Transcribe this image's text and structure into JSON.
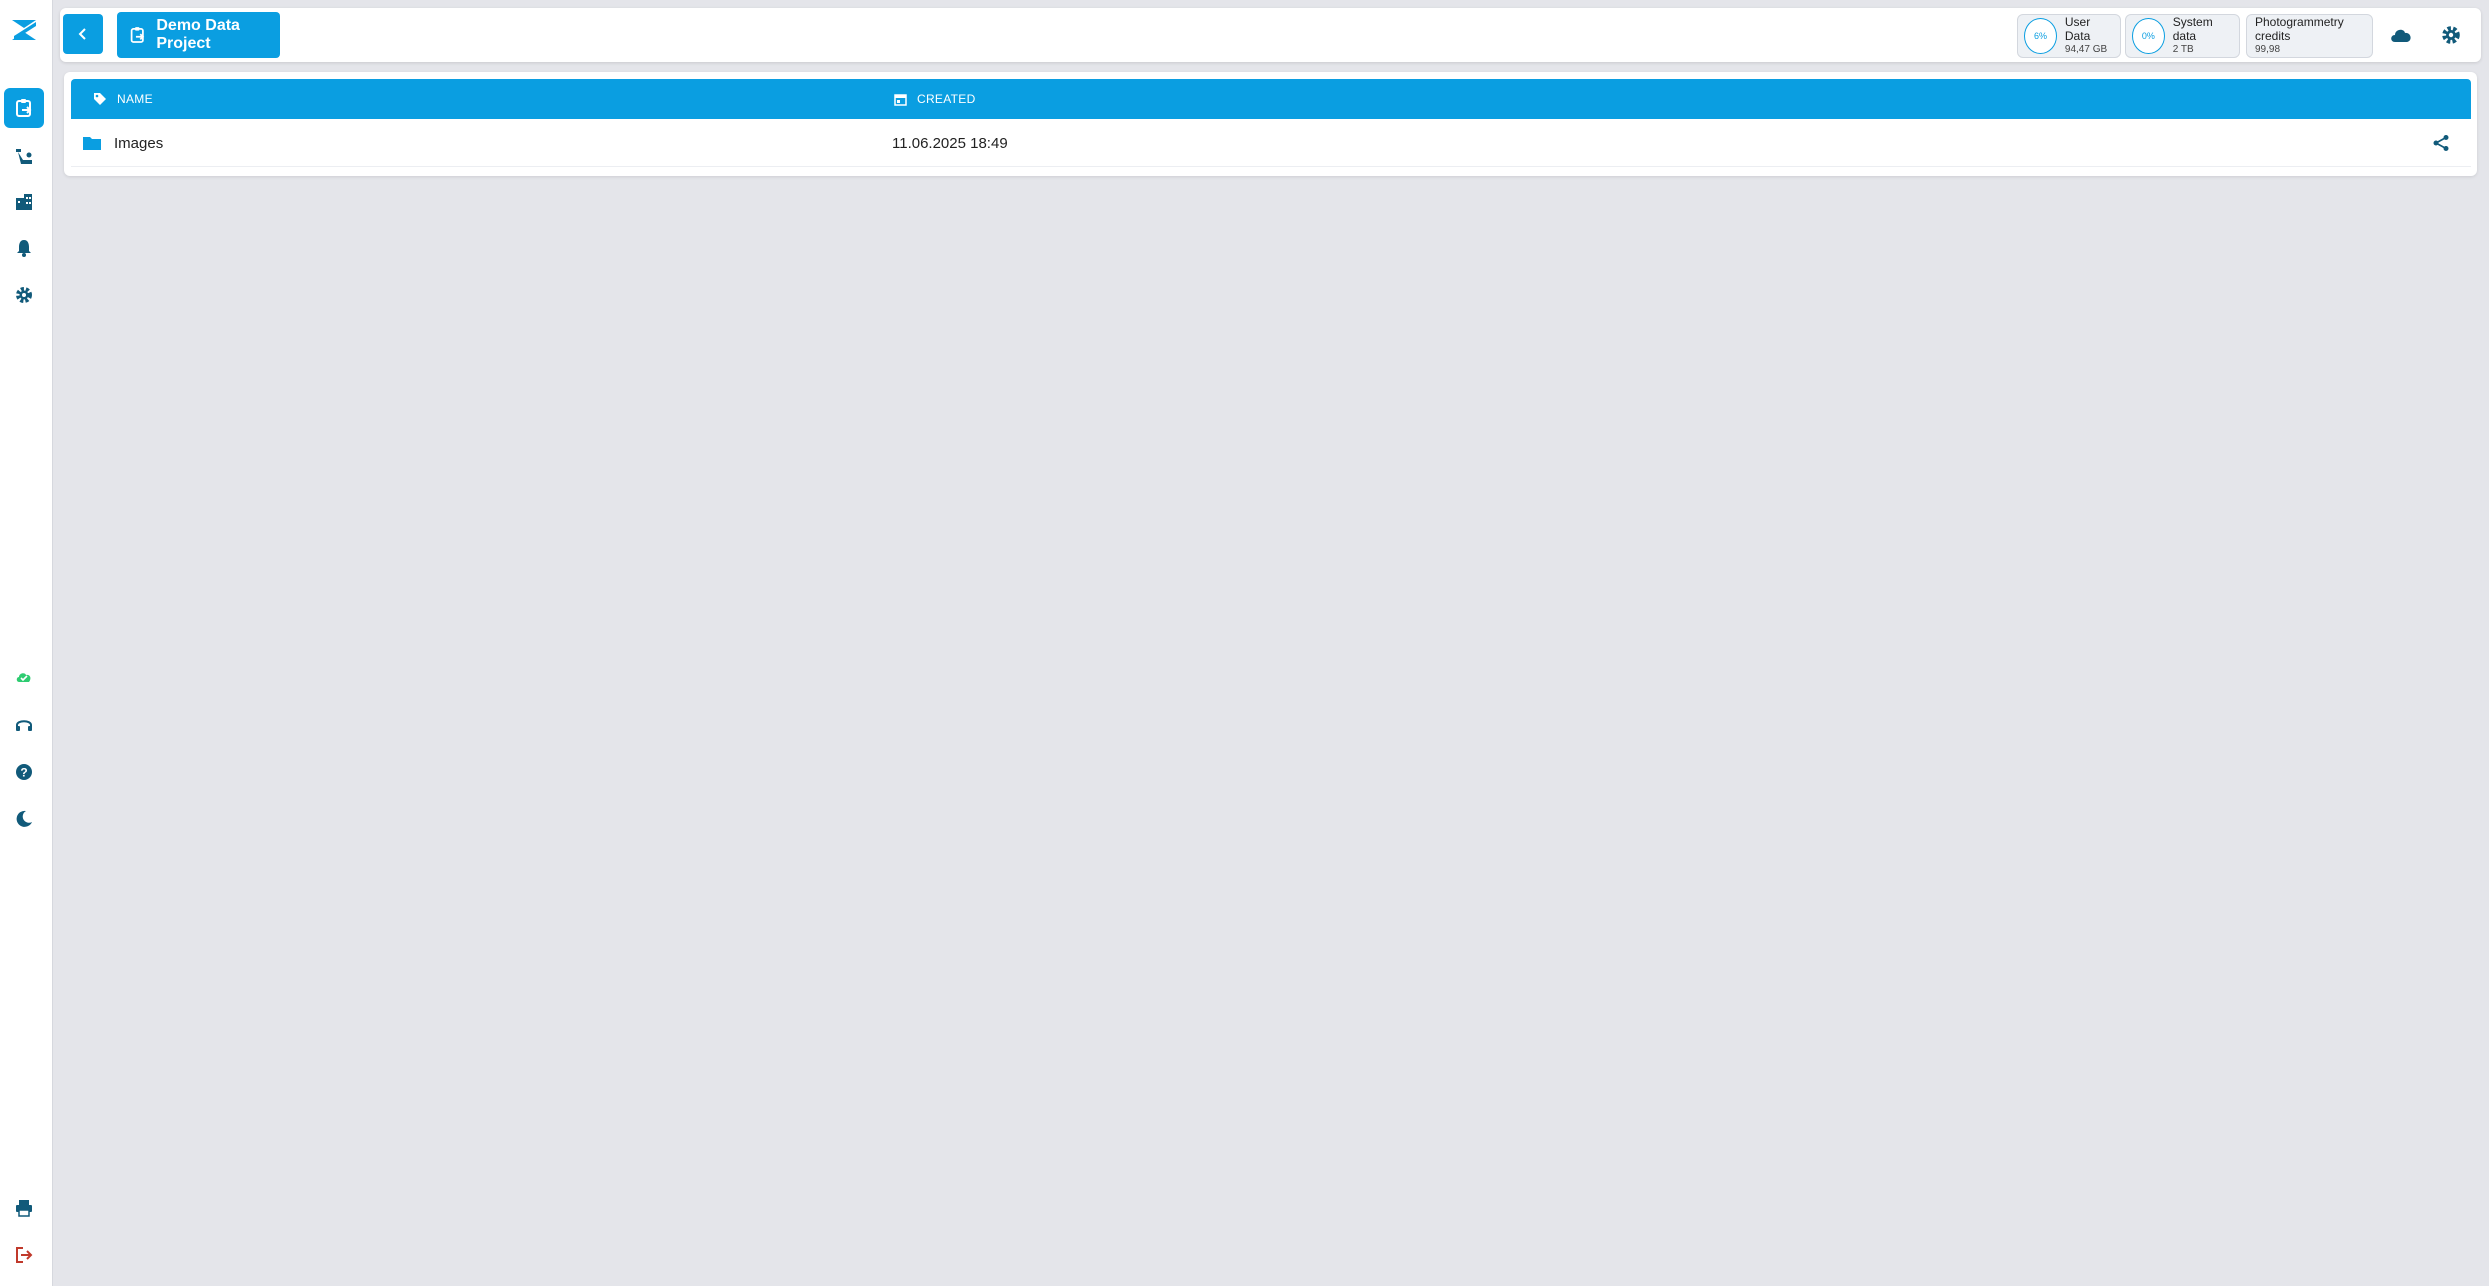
{
  "colors": {
    "accent": "#0a9ee1",
    "sidebar_icon": "#115a7a",
    "online": "#2ecc71",
    "logout": "#c0392b"
  },
  "sidebar": {
    "top_items": [
      {
        "name": "projects",
        "icon": "clipboard-share-icon"
      },
      {
        "name": "devices",
        "icon": "drone-icon"
      },
      {
        "name": "organizations",
        "icon": "buildings-icon"
      },
      {
        "name": "notifications",
        "icon": "bell-icon"
      },
      {
        "name": "settings",
        "icon": "gear-icon"
      }
    ],
    "bottom_items": [
      {
        "name": "cloud-status",
        "icon": "cloud-check-icon"
      },
      {
        "name": "support",
        "icon": "headset-icon"
      },
      {
        "name": "help",
        "icon": "help-circle-icon"
      },
      {
        "name": "dark-mode",
        "icon": "moon-icon"
      },
      {
        "name": "print",
        "icon": "print-icon"
      },
      {
        "name": "logout",
        "icon": "logout-icon"
      }
    ]
  },
  "header": {
    "project_title": "Demo Data Project",
    "stats": {
      "user_data": {
        "percent": "6%",
        "title": "User Data",
        "value": "94,47 GB"
      },
      "system_data": {
        "percent": "0%",
        "title": "System data",
        "value": "2 TB"
      },
      "credits": {
        "title": "Photogrammetry credits",
        "value": "99,98"
      }
    }
  },
  "table": {
    "columns": [
      "NAME",
      "CREATED"
    ],
    "rows": [
      {
        "name": "Images",
        "created": "11.06.2025 18:49",
        "icon": "folder-icon"
      }
    ]
  }
}
